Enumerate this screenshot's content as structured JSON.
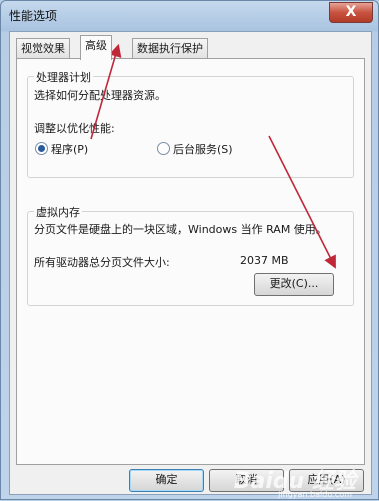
{
  "window": {
    "title": "性能选项",
    "close_label": "X"
  },
  "tabs": [
    {
      "label": "视觉效果"
    },
    {
      "label": "高级"
    },
    {
      "label": "数据执行保护"
    }
  ],
  "processor_group": {
    "title": "处理器计划",
    "description": "选择如何分配处理器资源。",
    "optimize_label": "调整以优化性能:",
    "options": [
      {
        "label": "程序(P)",
        "checked": true
      },
      {
        "label": "后台服务(S)",
        "checked": false
      }
    ]
  },
  "memory_group": {
    "title": "虚拟内存",
    "description": "分页文件是硬盘上的一块区域，Windows 当作 RAM 使用。",
    "total_label": "所有驱动器总分页文件大小:",
    "total_value": "2037 MB",
    "change_button": "更改(C)..."
  },
  "footer": {
    "ok": "确定",
    "cancel": "取消",
    "apply": "应用(A)"
  },
  "watermark": {
    "logo": "Baidu 经验",
    "url": "jingyan.baidu.com"
  },
  "colors": {
    "annotation_arrow": "#c0283a",
    "close_button": "#c8533f",
    "focus_border": "#3c7fb1"
  }
}
